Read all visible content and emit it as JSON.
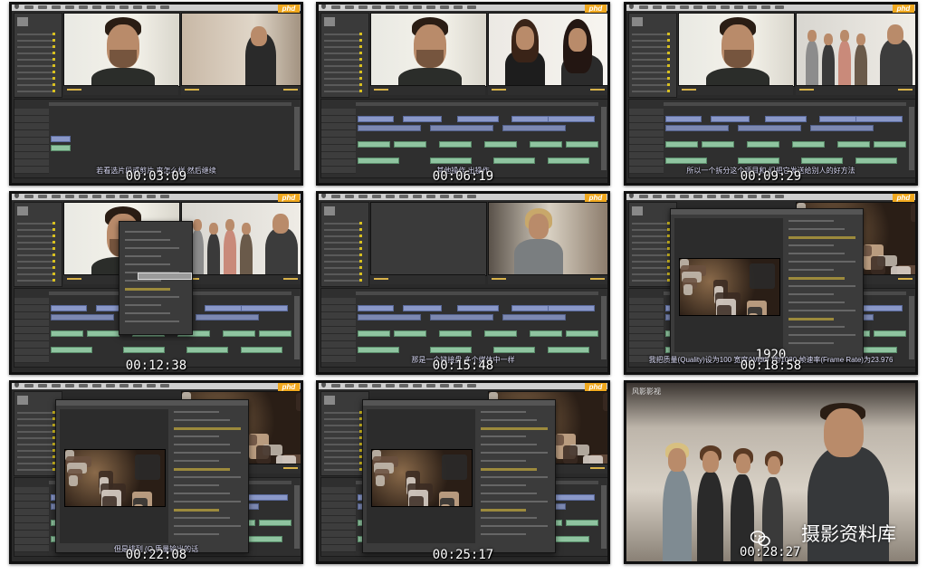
{
  "logo_text": "phd",
  "frames": [
    {
      "timecode": "00:03:09",
      "subtitle": "若看选片段或剪片                来怎么样 然后继续"
    },
    {
      "timecode": "00:06:19",
      "subtitle": "其他操作                     出操作"
    },
    {
      "timecode": "00:09:29",
      "subtitle": "所以一个拆分这个项目和                  们把它发送给别人的好方法"
    },
    {
      "timecode": "00:12:38",
      "subtitle": ""
    },
    {
      "timecode": "00:15:48",
      "subtitle": "那是一个链接盘                多个媒体中一样"
    },
    {
      "timecode": "00:18:58",
      "subtitle": "我把质量(Quality)设为100 宽度(Width          )为1080 帧速率(Frame Rate)为23.976",
      "overlay_number": "1920"
    },
    {
      "timecode": "00:22:08",
      "subtitle": "但是排列 (Q                            质量输出的话"
    },
    {
      "timecode": "00:25:17",
      "subtitle": "                              "
    },
    {
      "timecode": "00:28:27",
      "subtitle": "",
      "top_label": "风影影视"
    }
  ],
  "watermark": {
    "text": "摄影资料库",
    "icon": "wechat-icon"
  },
  "colors": {
    "accent": "#f0a81e",
    "panel": "#2f2f2f",
    "video_clip": "#8a98c8",
    "audio_clip": "#8fc4a0"
  }
}
